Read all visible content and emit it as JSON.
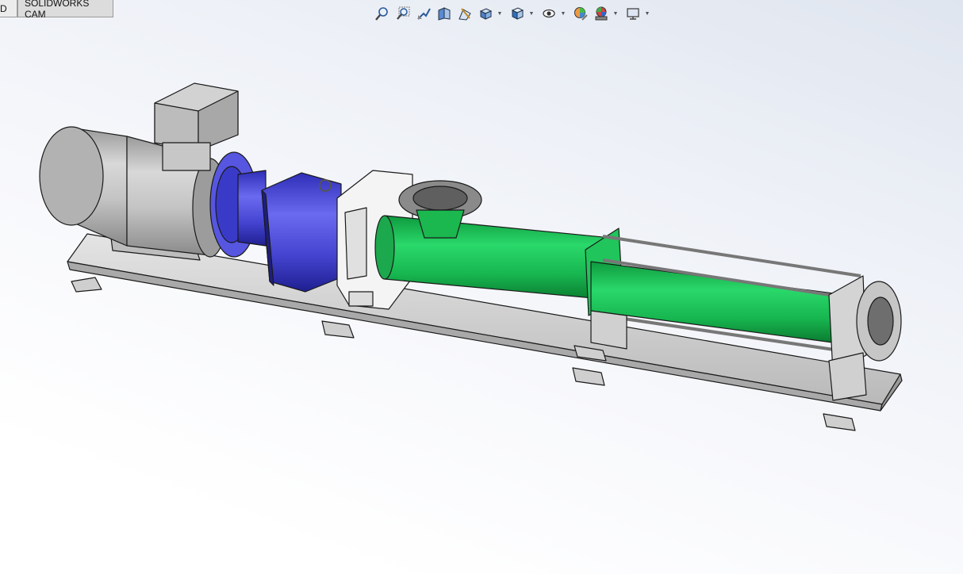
{
  "tabs": [
    {
      "label": "D",
      "active": false
    },
    {
      "label": "SOLIDWORKS CAM",
      "active": true
    }
  ],
  "heads_up_toolbar": [
    {
      "icon": "zoom-to-fit-icon",
      "dropdown": false
    },
    {
      "icon": "zoom-to-area-icon",
      "dropdown": false
    },
    {
      "icon": "previous-view-icon",
      "dropdown": false
    },
    {
      "icon": "section-view-icon",
      "dropdown": false
    },
    {
      "icon": "dynamic-annotation-views-icon",
      "dropdown": false
    },
    {
      "icon": "view-orientation-icon",
      "dropdown": true
    },
    {
      "icon": "display-style-icon",
      "dropdown": true
    },
    {
      "icon": "hide-show-items-icon",
      "dropdown": true
    },
    {
      "icon": "edit-appearance-icon",
      "dropdown": false
    },
    {
      "icon": "apply-scene-icon",
      "dropdown": true
    },
    {
      "icon": "view-settings-icon",
      "dropdown": true
    }
  ],
  "model": {
    "name": "progressive-cavity-pump-assembly",
    "colors": {
      "motor": "#c9c9c9",
      "gearbox": "#4b4bd8",
      "stator": "#1fbf5a",
      "frame": "#d6d6d6",
      "edge": "#1a1a1a"
    }
  }
}
